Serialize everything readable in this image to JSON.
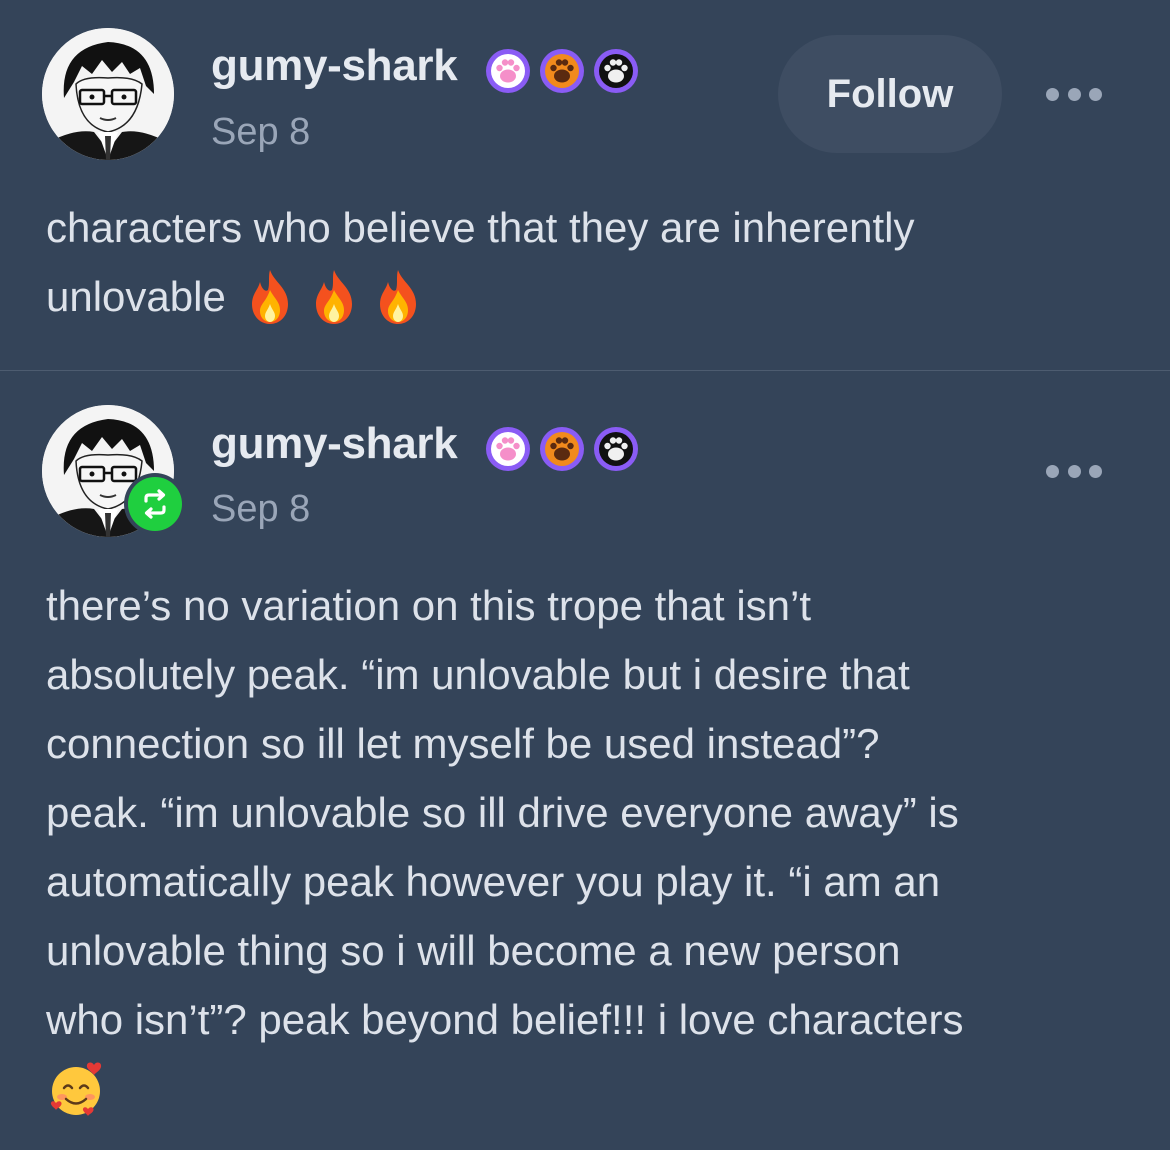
{
  "posts": [
    {
      "username": "gumy-shark",
      "date": "Sep 8",
      "follow_label": "Follow",
      "badges": [
        "paw-badge-pink",
        "paw-badge-orange",
        "paw-badge-black"
      ],
      "lines": [
        "characters who believe that they are inherently",
        "unlovable"
      ],
      "trailing_emojis": [
        "fire-emoji",
        "fire-emoji",
        "fire-emoji"
      ]
    },
    {
      "username": "gumy-shark",
      "date": "Sep 8",
      "reblog": true,
      "badges": [
        "paw-badge-pink",
        "paw-badge-orange",
        "paw-badge-black"
      ],
      "lines": [
        "there’s no variation on this trope that isn’t",
        "absolutely peak. “im unlovable but i desire that",
        "connection so ill let myself be used instead”?",
        "peak. “im unlovable so ill drive everyone away” is",
        "automatically peak however you play it. “i am an",
        "unlovable thing so i will become a new person",
        "who isn’t”? peak beyond belief!!! i love characters"
      ],
      "trailing_emojis": [
        "smiling-face-with-hearts-emoji"
      ]
    }
  ],
  "colors": {
    "background": "#344459",
    "follow_button": "#3e4d62",
    "reblog_green": "#1fcf3f",
    "badge_purple": "#8a5cf5"
  }
}
